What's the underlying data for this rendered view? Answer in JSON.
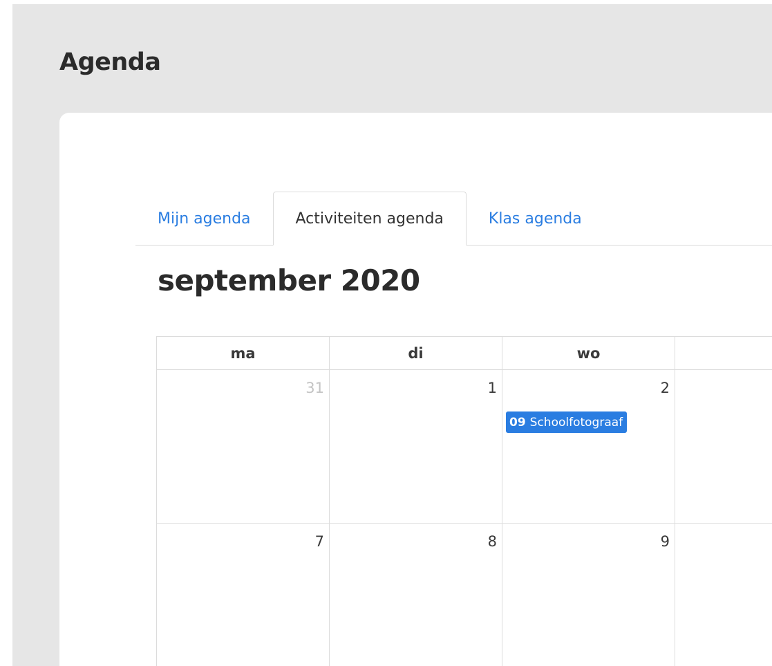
{
  "page": {
    "title": "Agenda"
  },
  "tabs": [
    {
      "label": "Mijn agenda",
      "active": false
    },
    {
      "label": "Activiteiten agenda",
      "active": true
    },
    {
      "label": "Klas agenda",
      "active": false
    }
  ],
  "calendar": {
    "month_title": "september 2020",
    "weekdays": [
      "ma",
      "di",
      "wo",
      ""
    ],
    "weeks": [
      [
        {
          "day": "31",
          "muted": true
        },
        {
          "day": "1",
          "muted": false
        },
        {
          "day": "2",
          "muted": false,
          "event": {
            "time": "09",
            "title": "Schoolfotograaf"
          }
        },
        {
          "day": "",
          "muted": false
        }
      ],
      [
        {
          "day": "7",
          "muted": false
        },
        {
          "day": "8",
          "muted": false
        },
        {
          "day": "9",
          "muted": false
        },
        {
          "day": "",
          "muted": false
        }
      ]
    ]
  },
  "colors": {
    "accent": "#2a7de1",
    "page_background": "#e6e6e6",
    "card_background": "#ffffff",
    "grid_border": "#dcdcdc",
    "muted_day": "#c4c4c4"
  }
}
